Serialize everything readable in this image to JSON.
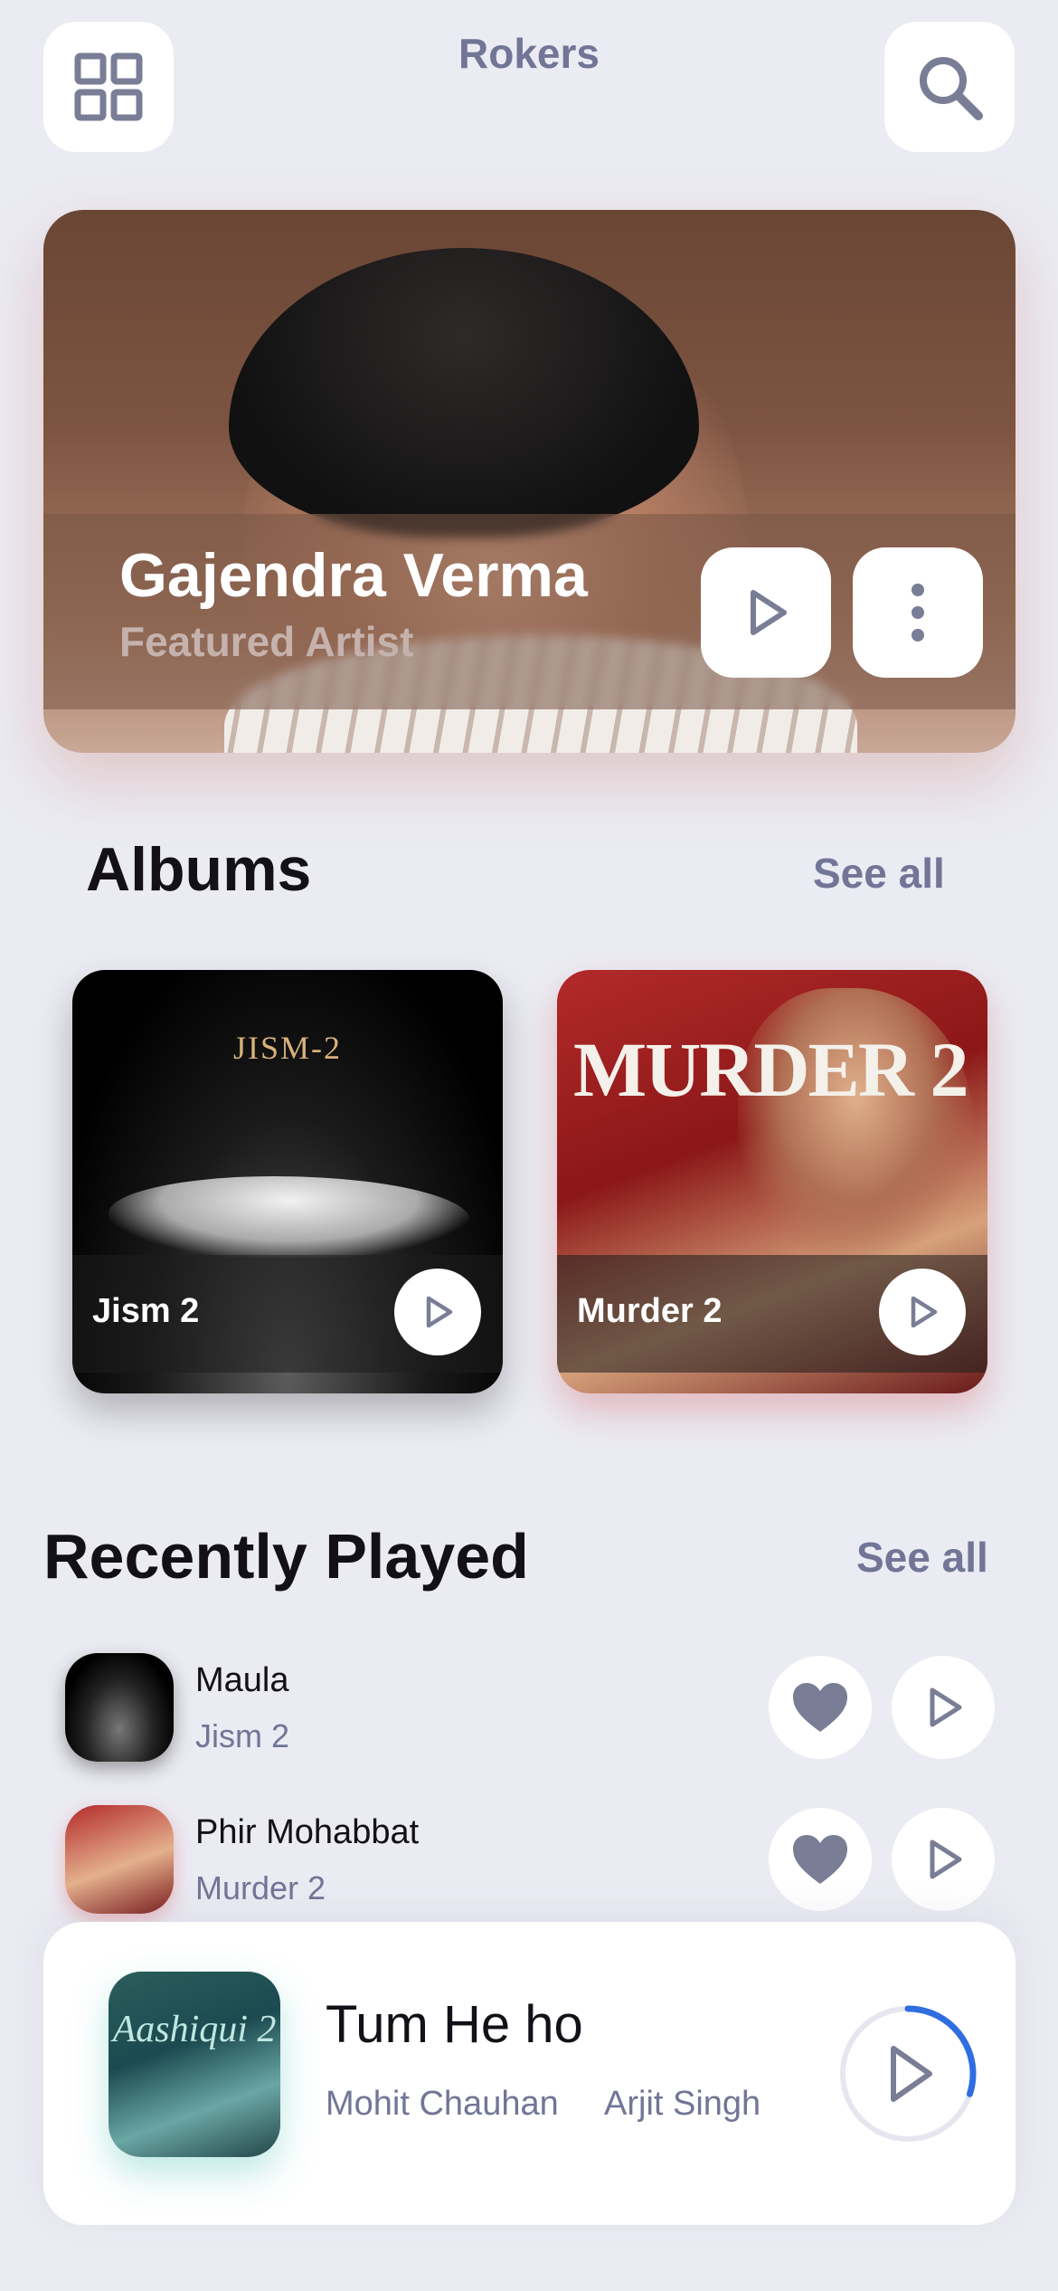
{
  "header": {
    "title": "Rokers",
    "menu_icon": "grid-icon",
    "search_icon": "search-icon"
  },
  "featured": {
    "artist_name": "Gajendra Verma",
    "subtitle": "Featured Artist"
  },
  "albums": {
    "heading": "Albums",
    "see_all": "See all",
    "items": [
      {
        "name": "Jism 2",
        "poster_title": "JISM-2"
      },
      {
        "name": "Murder 2",
        "poster_title": "MURDER 2"
      }
    ]
  },
  "recently_played": {
    "heading": "Recently Played",
    "see_all": "See all",
    "items": [
      {
        "title": "Maula",
        "album": "Jism 2"
      },
      {
        "title": "Phir Mohabbat",
        "album": "Murder 2"
      }
    ]
  },
  "now_playing": {
    "title": "Tum He ho",
    "artists": [
      "Mohit Chauhan",
      "Arjit Singh"
    ],
    "progress": 0.3,
    "poster_title": "Aashiqui 2"
  },
  "colors": {
    "background": "#ebebf3",
    "accent": "#2f6ee0",
    "muted_text": "#727596"
  }
}
